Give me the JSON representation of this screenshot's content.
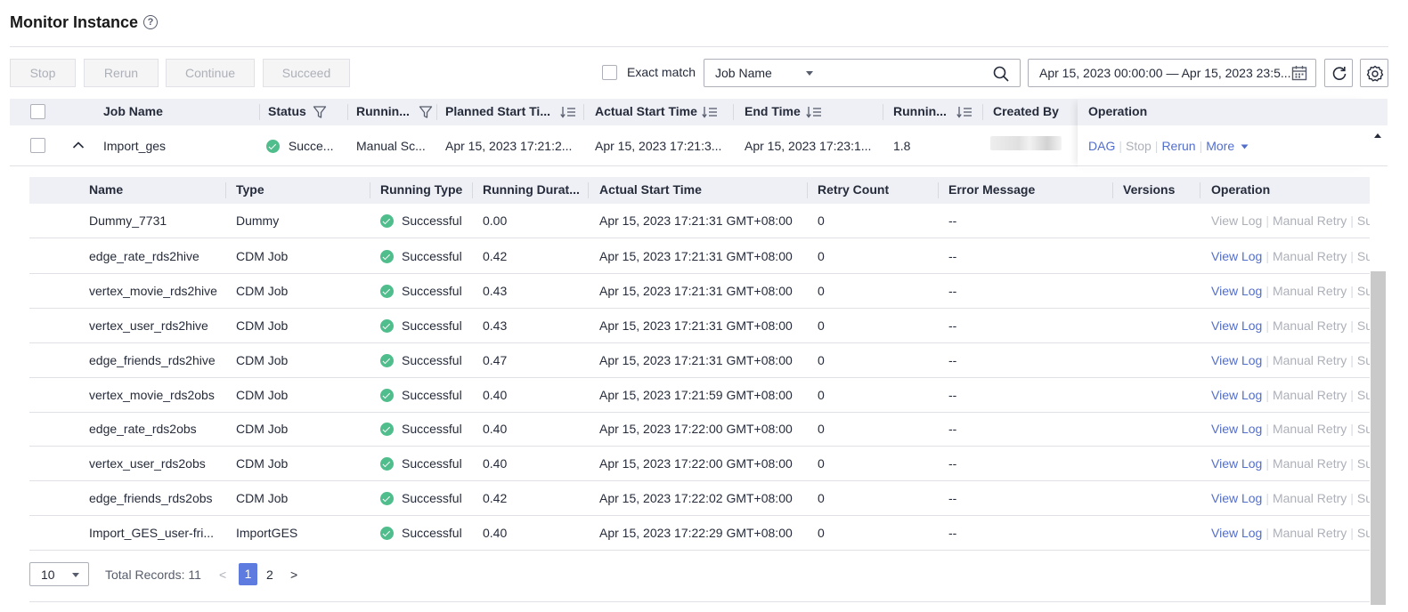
{
  "page": {
    "title": "Monitor Instance",
    "help_icon": "?"
  },
  "toolbar": {
    "stop": "Stop",
    "rerun": "Rerun",
    "continue": "Continue",
    "succeed": "Succeed"
  },
  "filter": {
    "exact_match": "Exact match",
    "field_select": "Job Name",
    "search_value": "",
    "date_range": "Apr 15, 2023 00:00:00 — Apr 15, 2023 23:5..."
  },
  "main_table": {
    "headers": {
      "job_name": "Job Name",
      "status": "Status",
      "running_type": "Runnin...",
      "planned_start": "Planned Start Ti...",
      "actual_start": "Actual Start Time",
      "end_time": "End Time",
      "running_duration": "Runnin...",
      "created_by": "Created By",
      "operation": "Operation"
    },
    "row": {
      "job_name": "Import_ges",
      "status": "Succe...",
      "running_type": "Manual Sc...",
      "planned_start": "Apr 15, 2023 17:21:2...",
      "actual_start": "Apr 15, 2023 17:21:3...",
      "end_time": "Apr 15, 2023 17:23:1...",
      "running_duration": "1.8",
      "ops": {
        "dag": "DAG",
        "stop": "Stop",
        "rerun": "Rerun",
        "more": "More"
      }
    }
  },
  "sub_table": {
    "headers": {
      "name": "Name",
      "type": "Type",
      "running_type": "Running Type",
      "running_duration": "Running Durat...",
      "actual_start": "Actual Start Time",
      "retry_count": "Retry Count",
      "error_message": "Error Message",
      "versions": "Versions",
      "operation": "Operation"
    },
    "op_labels": {
      "view_log": "View Log",
      "manual_retry": "Manual Retry",
      "succeed": "Succeed"
    },
    "rows": [
      {
        "name": "Dummy_7731",
        "type": "Dummy",
        "status": "Successful",
        "duration": "0.00",
        "start": "Apr 15, 2023 17:21:31 GMT+08:00",
        "retry": "0",
        "error": "--"
      },
      {
        "name": "edge_rate_rds2hive",
        "type": "CDM Job",
        "status": "Successful",
        "duration": "0.42",
        "start": "Apr 15, 2023 17:21:31 GMT+08:00",
        "retry": "0",
        "error": "--"
      },
      {
        "name": "vertex_movie_rds2hive",
        "type": "CDM Job",
        "status": "Successful",
        "duration": "0.43",
        "start": "Apr 15, 2023 17:21:31 GMT+08:00",
        "retry": "0",
        "error": "--"
      },
      {
        "name": "vertex_user_rds2hive",
        "type": "CDM Job",
        "status": "Successful",
        "duration": "0.43",
        "start": "Apr 15, 2023 17:21:31 GMT+08:00",
        "retry": "0",
        "error": "--"
      },
      {
        "name": "edge_friends_rds2hive",
        "type": "CDM Job",
        "status": "Successful",
        "duration": "0.47",
        "start": "Apr 15, 2023 17:21:31 GMT+08:00",
        "retry": "0",
        "error": "--"
      },
      {
        "name": "vertex_movie_rds2obs",
        "type": "CDM Job",
        "status": "Successful",
        "duration": "0.40",
        "start": "Apr 15, 2023 17:21:59 GMT+08:00",
        "retry": "0",
        "error": "--"
      },
      {
        "name": "edge_rate_rds2obs",
        "type": "CDM Job",
        "status": "Successful",
        "duration": "0.40",
        "start": "Apr 15, 2023 17:22:00 GMT+08:00",
        "retry": "0",
        "error": "--"
      },
      {
        "name": "vertex_user_rds2obs",
        "type": "CDM Job",
        "status": "Successful",
        "duration": "0.40",
        "start": "Apr 15, 2023 17:22:00 GMT+08:00",
        "retry": "0",
        "error": "--"
      },
      {
        "name": "edge_friends_rds2obs",
        "type": "CDM Job",
        "status": "Successful",
        "duration": "0.42",
        "start": "Apr 15, 2023 17:22:02 GMT+08:00",
        "retry": "0",
        "error": "--"
      },
      {
        "name": "Import_GES_user-fri...",
        "type": "ImportGES",
        "status": "Successful",
        "duration": "0.40",
        "start": "Apr 15, 2023 17:22:29 GMT+08:00",
        "retry": "0",
        "error": "--"
      }
    ]
  },
  "pagination": {
    "page_size": "10",
    "total": "Total Records: 11",
    "current": "1",
    "next_page": "2",
    "prev": "<",
    "next": ">"
  },
  "colors": {
    "accent": "#526ecc",
    "primary": "#5e7ce0",
    "success": "#50bd8c",
    "header_bg": "#eef0f5"
  }
}
